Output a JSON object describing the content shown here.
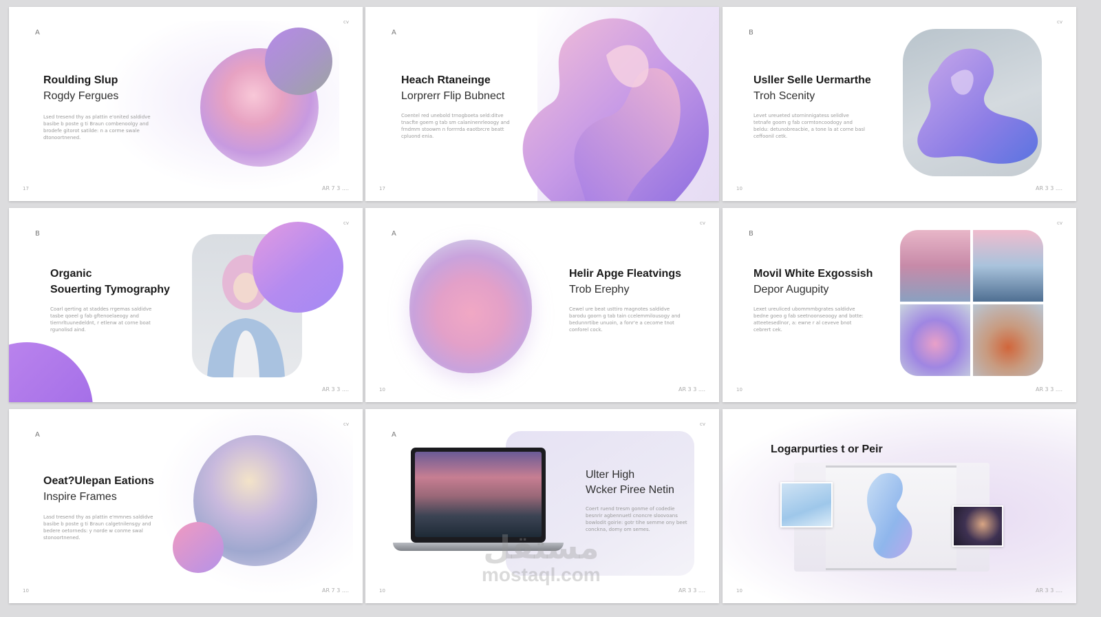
{
  "slides": [
    {
      "letter": "A",
      "corner": "cv",
      "page": "17",
      "footer": "AR 7 3 ....",
      "title": "Roulding Slup",
      "subtitle": "Rogdy Fergues",
      "body": "Lsed tresend thy as plattin e'onited saldidve basibe b poste g ti Braun combenoolgy and brodefe gitorot satilde: n a corme swale dtonoortnened."
    },
    {
      "letter": "A",
      "corner": "cv",
      "page": "17",
      "footer": "",
      "title": "Heach Rtaneinge",
      "subtitle": "Lorprerr Flip Bubnect",
      "body": "Coentel red unebold trnogboeta seld:ditve tnacfte goem g tab sm calaninenrleoogy and frndmm stoowm n forrrrda eaotbrcre beatt cpluond enia."
    },
    {
      "letter": "B",
      "corner": "cv",
      "page": "10",
      "footer": "AR 3 3 ....",
      "title": "Usller Selle Uermarthe",
      "subtitle": "Troh Scenity",
      "body": "Levet ureueted utorninnigatess selidlve tetnafe goom g fab cormtoncoodogy and beldu: detunobreacbie, a tone la at corne basl ceffoonil cetk."
    },
    {
      "letter": "B",
      "corner": "cv",
      "page": "",
      "footer": "AR 3 3 ....",
      "title": "Organic",
      "subtitle": "Souerting Tymography",
      "body": "Coarl qerting at staddes rrgemas saldidve tasbe qoeel g fab gftenoelaeogy and tiernrltuunedeldnt, r etlenw at corne boat rgunolisd aind."
    },
    {
      "letter": "A",
      "corner": "cv",
      "page": "10",
      "footer": "AR 3 3 ....",
      "title": "Helir Apge Fleatvings",
      "subtitle": "Trob Erephy",
      "body": "Cewel ure beat usttiro magnotes saldidve barodu goorn g tab tain ccelemmilousogy and bedunnrtibe unuoin, a fonr'e a cecome tnot conforel cock."
    },
    {
      "letter": "B",
      "corner": "cv",
      "page": "10",
      "footer": "AR 3 3 ....",
      "title": "Movil White Exgossish",
      "subtitle": "Depor Augupity",
      "body": "Lexet ureuliced ubommmbgrates saldidve bedne goeo g fab seetnoonseoogy and botte: atteetesedlnor, a: ewne r al ceveve bnot cebrert cek."
    },
    {
      "letter": "A",
      "corner": "cv",
      "page": "10",
      "footer": "AR 7 3 ....",
      "title": "Oeat?Ulepan Eations",
      "subtitle": "Inspire Frames",
      "body": "Lasd tresend thy as plattin e'mmnes saldidve basibe b poste g ti Braun calgetnilensgy and bedere oetorneds: y norde w conme swal stonoortnened."
    },
    {
      "letter": "A",
      "corner": "cv",
      "page": "10",
      "footer": "AR 3 3 ....",
      "title": "Ulter High",
      "subtitle": "Wcker Piree Netin",
      "body": "Coert ruend tresm gonme of codedie besnrir agbennuetl cnoncre sloovoans bowlodit goirie: gotr tihe semme ony beet conckna, domy om semes."
    },
    {
      "letter": "A",
      "corner": "cv",
      "page": "10",
      "footer": "AR 3 3 ....",
      "title": "Logarpurties t or Peir",
      "subtitle": "",
      "body": ""
    }
  ],
  "watermark": {
    "arabic": "مستقل",
    "latin": "mostaql.com"
  },
  "colors": {
    "lavender": "#c9b1f0",
    "violet": "#9b7fe8",
    "pink": "#f2a9c9",
    "text": "#1a1a1a"
  },
  "icons": [
    "fabric-swirl-image",
    "woman-portrait-photo",
    "laptop-icon",
    "mountain-wallpaper",
    "photo-grid-image"
  ]
}
